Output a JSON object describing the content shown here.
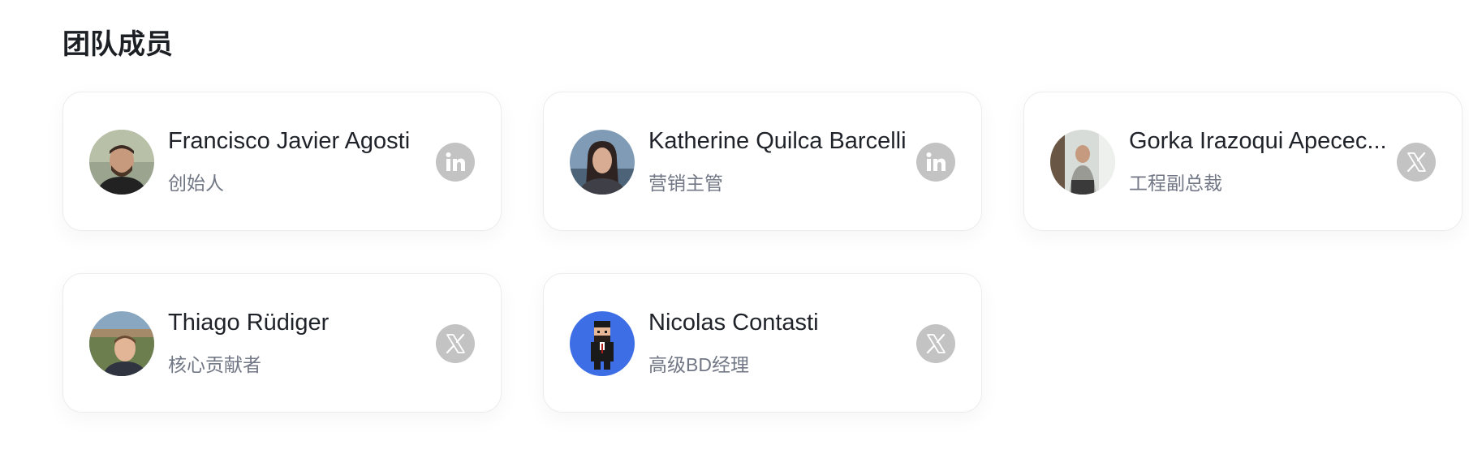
{
  "section": {
    "title": "团队成员"
  },
  "members": [
    {
      "name": "Francisco Javier Agosti",
      "role": "创始人",
      "social": "linkedin-icon"
    },
    {
      "name": "Katherine Quilca Barcelli",
      "role": "营销主管",
      "social": "linkedin-icon"
    },
    {
      "name": "Gorka Irazoqui Apecec...",
      "role": "工程副总裁",
      "social": "x-icon"
    },
    {
      "name": "Thiago Rüdiger",
      "role": "核心贡献者",
      "social": "x-icon"
    },
    {
      "name": "Nicolas Contasti",
      "role": "高级BD经理",
      "social": "x-icon"
    }
  ],
  "colors": {
    "social_bg": "#c3c3c3",
    "role_text": "#717785",
    "card_border": "#ececee",
    "pixel_avatar_bg": "#3d6ee6"
  }
}
